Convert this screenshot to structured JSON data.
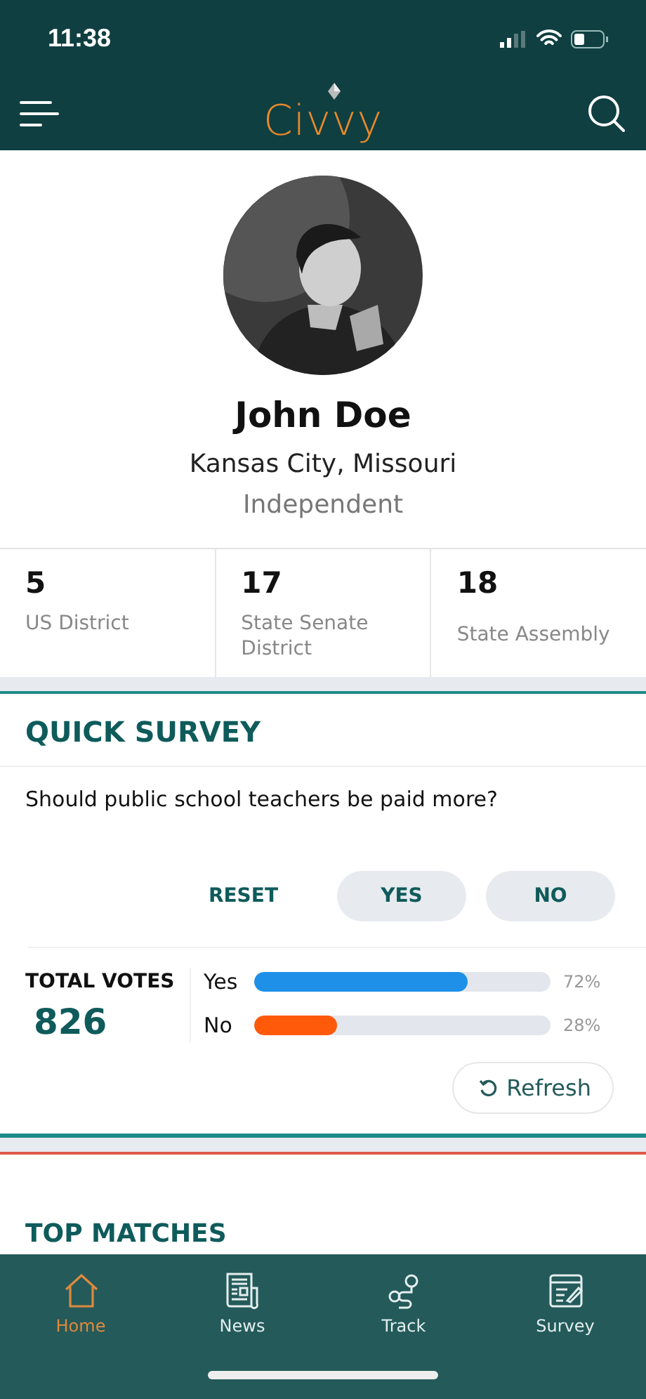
{
  "status_bar": {
    "time": "11:38"
  },
  "header": {
    "logo": "Civvy"
  },
  "profile": {
    "name": "John Doe",
    "location": "Kansas City, Missouri",
    "party": "Independent"
  },
  "districts": [
    {
      "number": "5",
      "label": "US District"
    },
    {
      "number": "17",
      "label": "State Senate District"
    },
    {
      "number": "18",
      "label": "State Assembly"
    }
  ],
  "quick_survey": {
    "title": "QUICK SURVEY",
    "question": "Should public school teachers be paid more?",
    "buttons": [
      {
        "label": "RESET",
        "kind": "text"
      },
      {
        "label": "YES",
        "kind": "pill"
      },
      {
        "label": "NO",
        "kind": "pill"
      }
    ],
    "total_label": "TOTAL VOTES",
    "total": "826",
    "results": [
      {
        "label": "Yes",
        "level": 0.72,
        "reading": "72%",
        "color": "#1e90e8"
      },
      {
        "label": "No",
        "level": 0.28,
        "reading": "28%",
        "color": "#ff5a0a"
      }
    ],
    "refresh": "Refresh"
  },
  "next_section": {
    "title": "TOP MATCHES"
  },
  "tab_bar": [
    {
      "label": "Home",
      "selected": true
    },
    {
      "label": "News",
      "selected": false
    },
    {
      "label": "Track",
      "selected": false
    },
    {
      "label": "Survey",
      "selected": false
    }
  ]
}
